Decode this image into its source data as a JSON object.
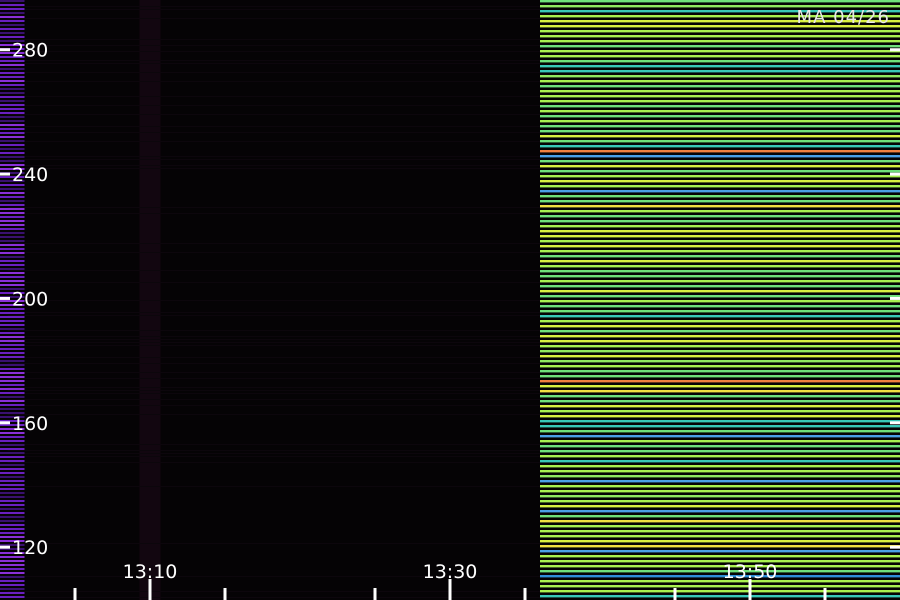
{
  "chart_data": {
    "type": "heatmap",
    "title": "MA 04/26",
    "xlabel": "",
    "ylabel": "",
    "x_axis": {
      "unit": "time",
      "range": [
        "13:00",
        "13:60"
      ],
      "tick_labels": [
        "13:10",
        "13:30",
        "13:50"
      ],
      "major_ticks_min": [
        10,
        30,
        50
      ],
      "minor_ticks_min": [
        5,
        15,
        25,
        35,
        45,
        55
      ]
    },
    "y_axis": {
      "range": [
        103,
        296
      ],
      "ticks": [
        120,
        160,
        200,
        240,
        280
      ],
      "tick_labels": [
        "120",
        "160",
        "200",
        "240",
        "280"
      ]
    },
    "grid": false,
    "legend": "none",
    "bands": [
      {
        "region": "left-edge",
        "x_range_min": [
          0,
          0.5
        ],
        "description": "purple",
        "color": "#6a1fc0"
      },
      {
        "region": "dark",
        "x_range_min": [
          0.5,
          36
        ],
        "color": "#050305"
      },
      {
        "region": "dim-column",
        "x_range_min": [
          9.3,
          10.7
        ],
        "color": "#120610"
      },
      {
        "region": "active",
        "x_range_min": [
          36,
          60
        ],
        "palette": [
          "#a8f050",
          "#6fe07a",
          "#38c8b8",
          "#4aa0e8",
          "#d8f040",
          "#f0e040",
          "#f08040",
          "#e03060",
          "#90e860",
          "#2f8fd8"
        ]
      }
    ]
  },
  "colors": {
    "background": "#050305",
    "axis_text": "#ffffff",
    "title_text": "#e8e8e8"
  }
}
